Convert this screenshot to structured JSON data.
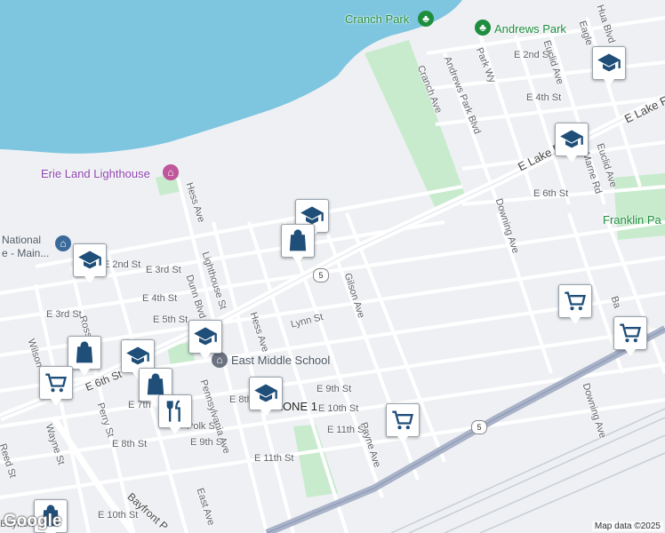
{
  "map": {
    "water_color": "#7ec5df",
    "park_color": "#c7ebcc",
    "road_color": "#ffffff",
    "highway_color": "#a8b2c8",
    "pin_color": "#1f4e79",
    "route_shield": "5",
    "attribution": "Map data ©2025",
    "logo": "Google"
  },
  "places": {
    "cranch_park": "Cranch Park",
    "andrews_park": "Andrews Park",
    "lighthouse": "Erie Land Lighthouse",
    "national": "National",
    "national_line2": "e - Main...",
    "east_middle": "East Middle School",
    "franklin_park": "Franklin Pa"
  },
  "streets": [
    "E 2nd St",
    "Euclid Ave",
    "Eagle",
    "Park Wy",
    "Andrews Park Blvd",
    "Cranch Ave",
    "E 4th St",
    "E Lake Rd",
    "Euclid Ave",
    "Marne Rd",
    "E 6th St",
    "Downing Ave",
    "E Lake Rd",
    "Hess Ave",
    "Gilson Ave",
    "Lynn St",
    "Lighthouse St",
    "Dunn Blvd",
    "Hess Ave",
    "E 3rd St",
    "E 2nd St",
    "E 4th St",
    "E 5th St",
    "E 3rd St",
    "Ross",
    "Wilson",
    "E 6th St",
    "Perry St",
    "E 7th",
    "E 8th",
    "E 8th St",
    "Polk St",
    "E 9th St",
    "Pennsylvania Ave",
    "E 9th St",
    "E 10th St",
    "E 11th St",
    "Payne Ave",
    "E 11th St",
    "Wayne St",
    "Reed St",
    "Bayfront P",
    "E 10th St",
    "East Ave",
    "Downing Ave",
    "Ba",
    "ZONE 1",
    "Bayfront P",
    "Hua Blvd"
  ],
  "pins": [
    {
      "kind": "school-icon"
    },
    {
      "kind": "school-icon"
    },
    {
      "kind": "school-icon"
    },
    {
      "kind": "school-icon"
    },
    {
      "kind": "school-icon"
    },
    {
      "kind": "school-icon"
    },
    {
      "kind": "school-icon"
    },
    {
      "kind": "shopping-bag-icon"
    },
    {
      "kind": "shopping-bag-icon"
    },
    {
      "kind": "shopping-bag-icon"
    },
    {
      "kind": "shopping-bag-icon"
    },
    {
      "kind": "cart-icon"
    },
    {
      "kind": "cart-icon"
    },
    {
      "kind": "cart-icon"
    },
    {
      "kind": "cart-icon"
    },
    {
      "kind": "restaurant-icon"
    }
  ]
}
